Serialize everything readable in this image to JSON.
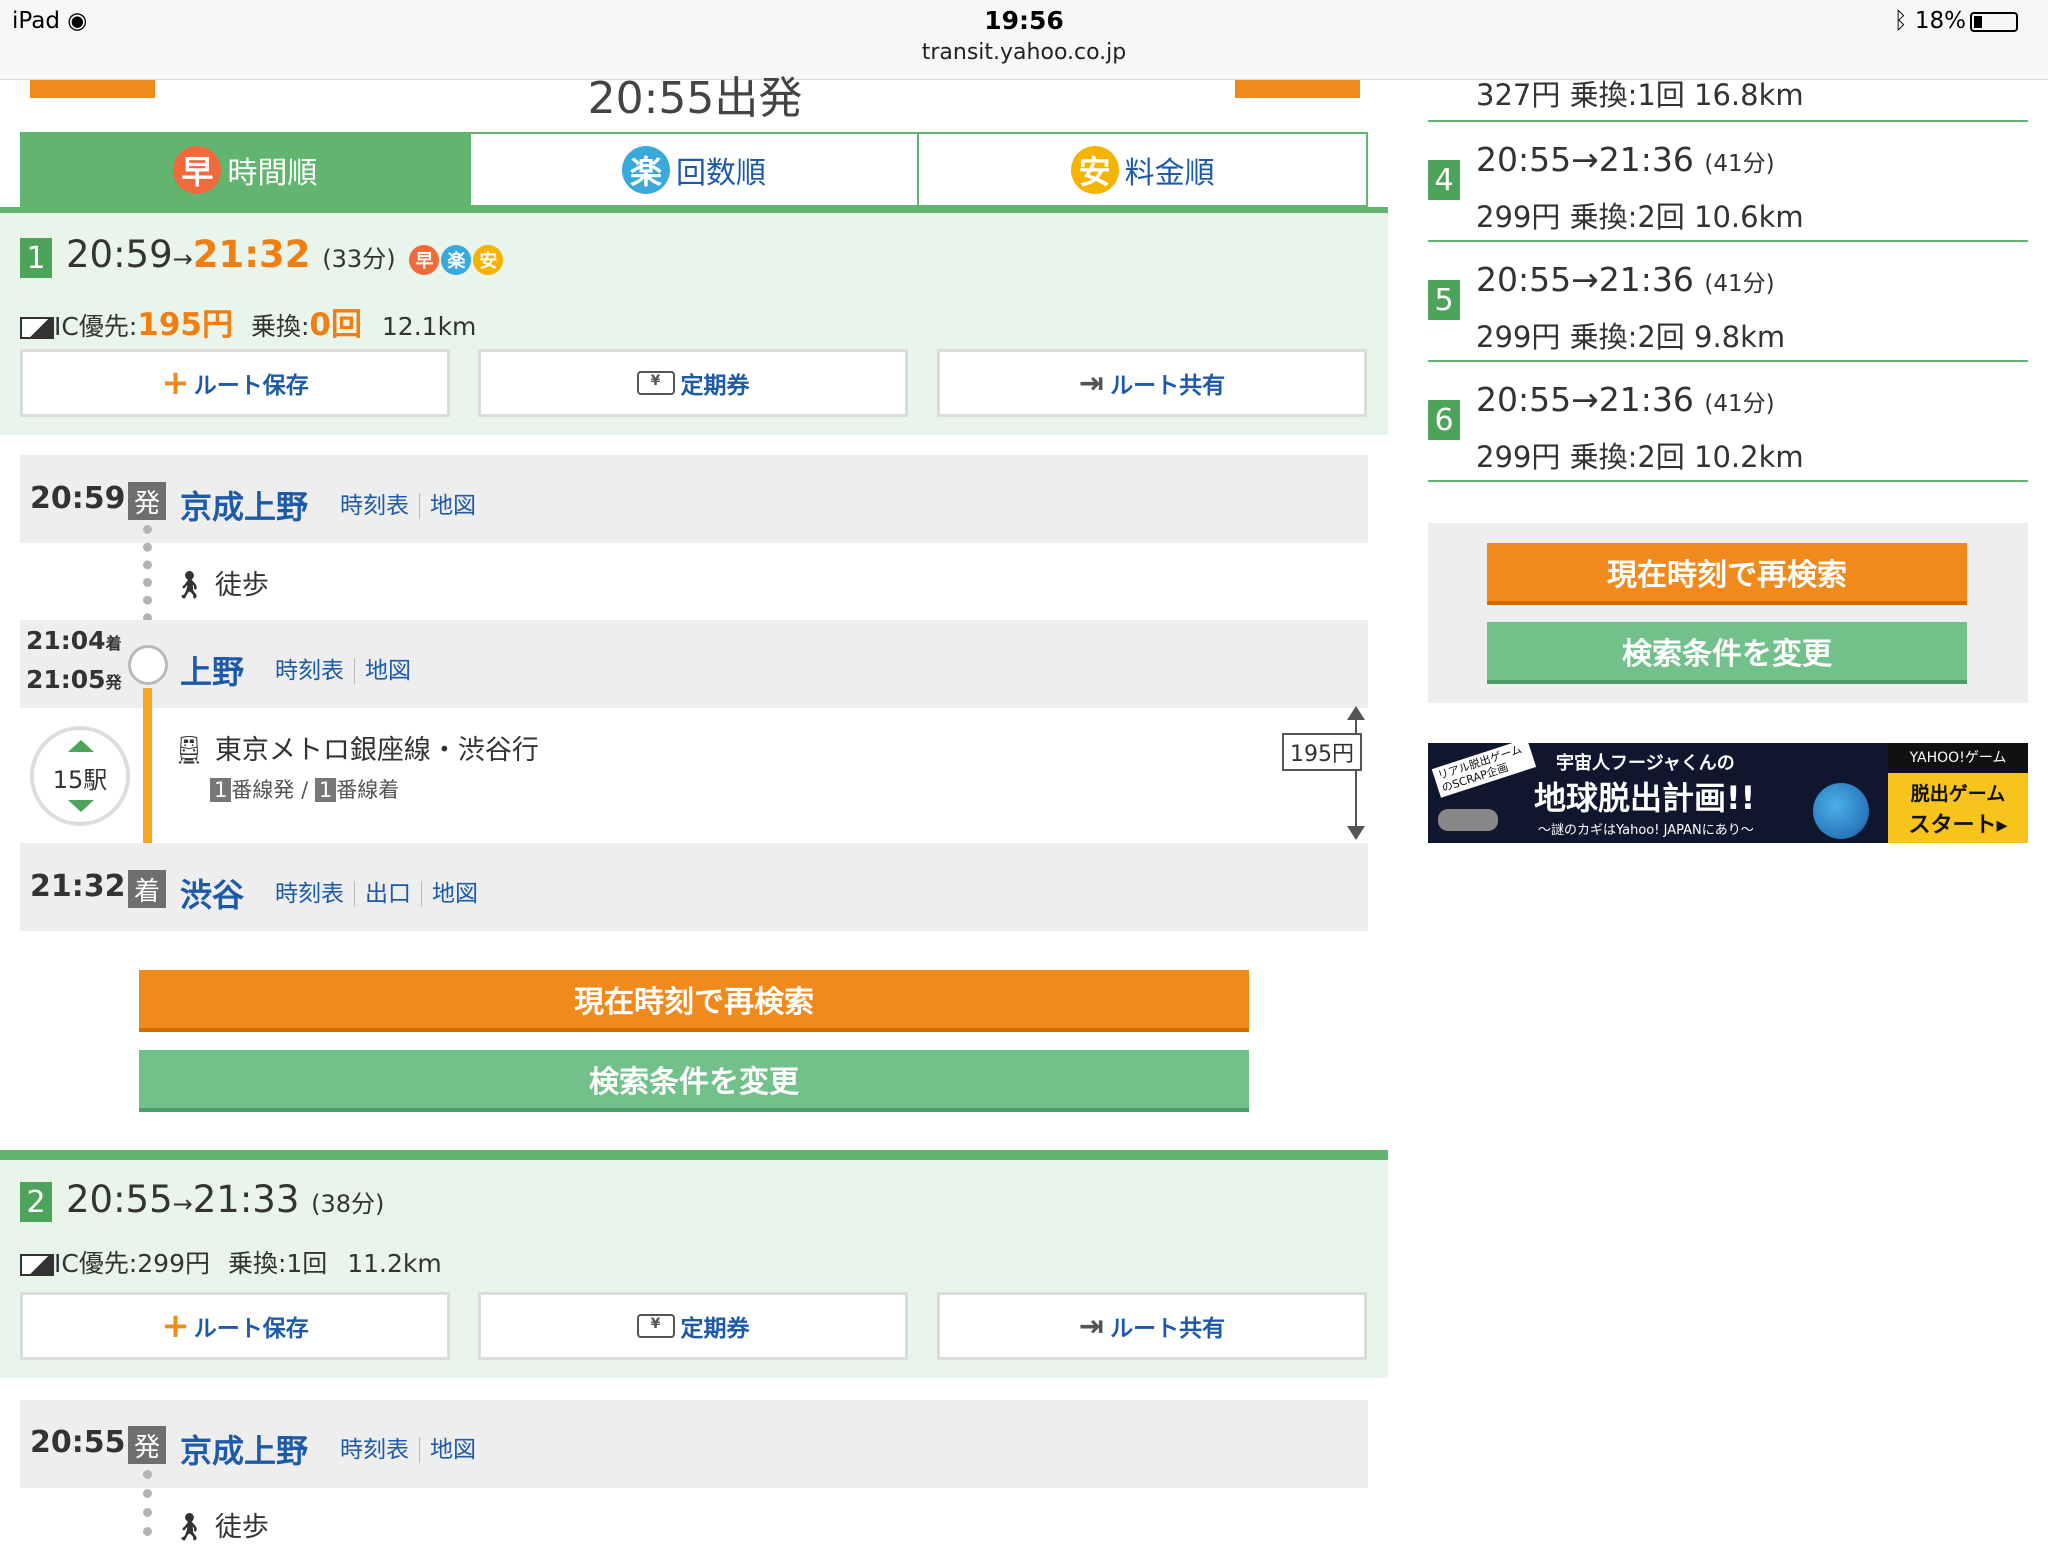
{
  "status": {
    "device": "iPad",
    "time": "19:56",
    "url": "transit.yahoo.co.jp",
    "battery": "18%"
  },
  "header": {
    "departure": "20:55出発"
  },
  "tabs": [
    {
      "icon": "早",
      "label": "時間順",
      "color": "#f06a3c"
    },
    {
      "icon": "楽",
      "label": "回数順",
      "color": "#39a9db"
    },
    {
      "icon": "安",
      "label": "料金順",
      "color": "#f5b400"
    }
  ],
  "route1": {
    "num": "1",
    "dep": "20:59",
    "arrow": "→",
    "arr": "21:32",
    "duration": "(33分)",
    "badges": [
      "早",
      "楽",
      "安"
    ],
    "ic": "IC優先:",
    "fare": "195円",
    "transfer_label": "乗換:",
    "transfer": "0回",
    "distance": "12.1km"
  },
  "actions": {
    "save": "ルート保存",
    "commuter": "定期券",
    "share": "ルート共有"
  },
  "detail1": {
    "s1": {
      "time": "20:59",
      "tag": "発",
      "name": "京成上野",
      "links": [
        "時刻表",
        "地図"
      ]
    },
    "walk": "徒歩",
    "s2": {
      "arr": "21:04",
      "arr_tag": "着",
      "dep": "21:05",
      "dep_tag": "発",
      "name": "上野",
      "links": [
        "時刻表",
        "地図"
      ]
    },
    "stops": "15駅",
    "line": "東京メトロ銀座線・渋谷行",
    "plat_dep_num": "1",
    "plat_dep": "番線発",
    "plat_sep": "/",
    "plat_arr_num": "1",
    "plat_arr": "番線着",
    "fare": "195円",
    "s3": {
      "time": "21:32",
      "tag": "着",
      "name": "渋谷",
      "links": [
        "時刻表",
        "出口",
        "地図"
      ]
    }
  },
  "buttons": {
    "research": "現在時刻で再検索",
    "change": "検索条件を変更"
  },
  "route2": {
    "num": "2",
    "dep": "20:55",
    "arrow": "→",
    "arr": "21:33",
    "duration": "(38分)",
    "ic": "IC優先:299円",
    "transfer": "乗換:1回",
    "distance": "11.2km"
  },
  "detail2": {
    "s1": {
      "time": "20:55",
      "tag": "発",
      "name": "京成上野",
      "links": [
        "時刻表",
        "地図"
      ]
    },
    "walk": "徒歩"
  },
  "side_routes": [
    {
      "num": "",
      "time": "",
      "dur": "",
      "info": "327円 乗換:1回 16.8km"
    },
    {
      "num": "4",
      "time": "20:55→21:36",
      "dur": "(41分)",
      "info": "299円 乗換:2回 10.6km"
    },
    {
      "num": "5",
      "time": "20:55→21:36",
      "dur": "(41分)",
      "info": "299円 乗換:2回 9.8km"
    },
    {
      "num": "6",
      "time": "20:55→21:36",
      "dur": "(41分)",
      "info": "299円 乗換:2回 10.2km"
    }
  ],
  "ad": {
    "badge": "リアル脱出ゲームのSCRAP企画",
    "headline1": "宇宙人フージャくんの",
    "headline2": "地球脱出計画!!",
    "sub": "〜謎のカギはYahoo! JAPANにあり〜",
    "brand": "YAHOO!ゲーム",
    "cta1": "脱出ゲーム",
    "cta2": "スタート▸"
  }
}
